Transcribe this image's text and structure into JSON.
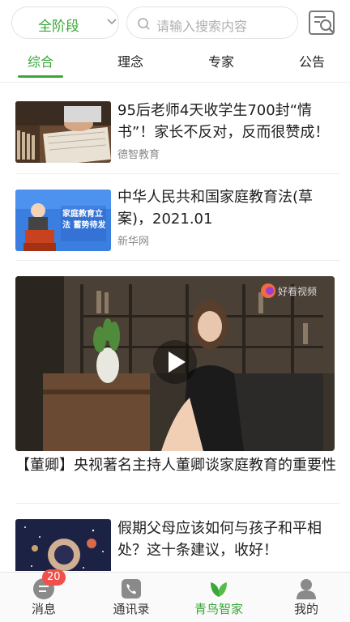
{
  "header": {
    "stage_select": "全阶段",
    "search_placeholder": "请输入搜索内容"
  },
  "tabs": [
    {
      "label": "综合",
      "active": true
    },
    {
      "label": "理念",
      "active": false
    },
    {
      "label": "专家",
      "active": false
    },
    {
      "label": "公告",
      "active": false
    }
  ],
  "feed": [
    {
      "title": "95后老师4天收学生700封“情书”！家长不反对，反而很赞成！",
      "source": "德智教育"
    },
    {
      "title": "中华人民共和国家庭教育法(草案)，2021.01",
      "source": "新华网",
      "thumb_text": "家庭教育立法 蓄势待发"
    },
    {
      "title": "【董卿】央视著名主持人董卿谈家庭教育的重要性",
      "type": "video"
    },
    {
      "title": "假期父母应该如何与孩子和平相处？这十条建议，收好！"
    }
  ],
  "bottom_nav": [
    {
      "label": "消息",
      "badge": "20",
      "icon": "message-icon",
      "active": false
    },
    {
      "label": "通讯录",
      "icon": "phone-icon",
      "active": false
    },
    {
      "label": "青鸟智家",
      "icon": "leaf-icon",
      "active": true
    },
    {
      "label": "我的",
      "icon": "user-icon",
      "active": false
    }
  ],
  "colors": {
    "accent": "#3aa73a",
    "badge": "#f0504a",
    "divider": "#ececec"
  }
}
